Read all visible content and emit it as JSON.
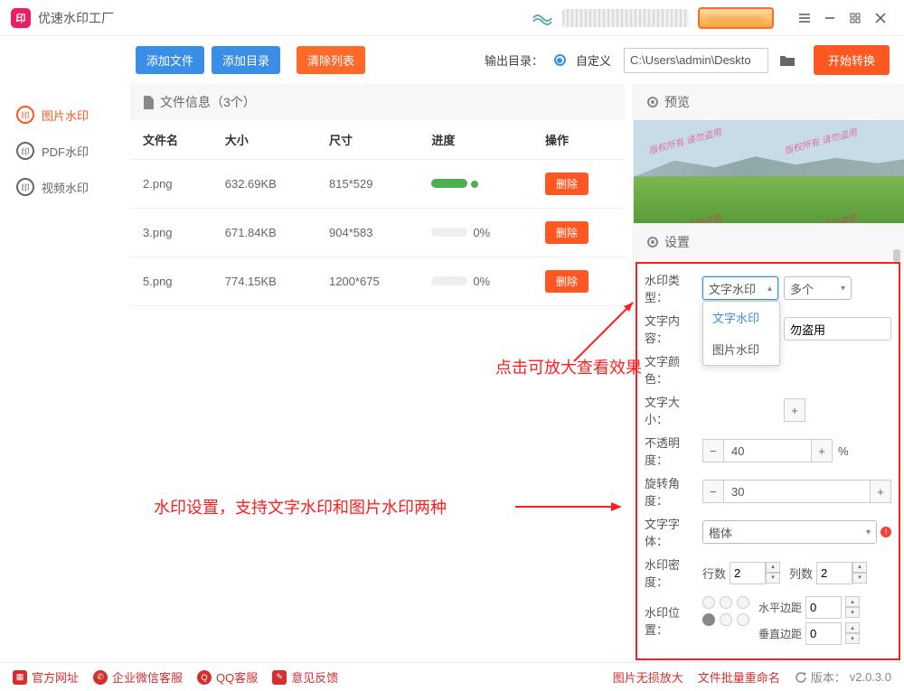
{
  "titlebar": {
    "app_name": "优速水印工厂"
  },
  "toolbar": {
    "add_file": "添加文件",
    "add_dir": "添加目录",
    "clear_list": "清除列表",
    "out_dir_label": "输出目录：",
    "custom": "自定义",
    "path": "C:\\Users\\admin\\Deskto",
    "start": "开始转换"
  },
  "sidebar": {
    "items": [
      {
        "label": "图片水印",
        "active": true
      },
      {
        "label": "PDF水印",
        "active": false
      },
      {
        "label": "视频水印",
        "active": false
      }
    ]
  },
  "filepanel": {
    "title": "文件信息（3个）",
    "cols": {
      "name": "文件名",
      "size": "大小",
      "dim": "尺寸",
      "prog": "进度",
      "op": "操作"
    },
    "rows": [
      {
        "name": "2.png",
        "size": "632.69KB",
        "dim": "815*529",
        "progress": "done",
        "pct": ""
      },
      {
        "name": "3.png",
        "size": "671.84KB",
        "dim": "904*583",
        "progress": "none",
        "pct": "0%"
      },
      {
        "name": "5.png",
        "size": "774.15KB",
        "dim": "1200*675",
        "progress": "none",
        "pct": "0%"
      }
    ],
    "del": "删除"
  },
  "annotations": {
    "a1": "点击可放大查看效果",
    "a2": "水印设置，支持文字水印和图片水印两种"
  },
  "preview": {
    "title": "预览",
    "wm_sample": "版权所有 请勿盗用"
  },
  "settings": {
    "title": "设置",
    "type_label": "水印类型：",
    "type_value": "文字水印",
    "type_options": [
      "文字水印",
      "图片水印"
    ],
    "count_value": "多个",
    "text_label": "文字内容：",
    "text_value": "勿盗用",
    "color_label": "文字颜色：",
    "size_label": "文字大小：",
    "opacity_label": "不透明度：",
    "opacity_value": "40",
    "pct": "%",
    "rotate_label": "旋转角度：",
    "rotate_value": "30",
    "font_label": "文字字体：",
    "font_value": "楷体",
    "density_label": "水印密度：",
    "rows_label": "行数",
    "rows_value": "2",
    "cols_label": "列数",
    "cols_value": "2",
    "pos_label": "水印位置：",
    "hmargin_label": "水平边距",
    "hmargin_value": "0",
    "vmargin_label": "垂直边距",
    "vmargin_value": "0"
  },
  "footer": {
    "site": "官方网址",
    "wechat": "企业微信客服",
    "qq": "QQ客服",
    "feedback": "意见反馈",
    "enlarge": "图片无损放大",
    "rename": "文件批量重命名",
    "version_label": "版本：",
    "version": "v2.0.3.0"
  }
}
